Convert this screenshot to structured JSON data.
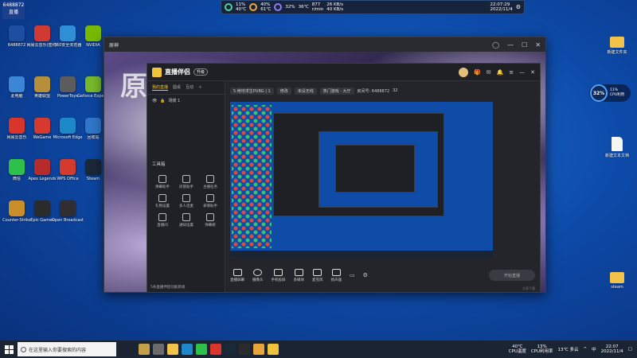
{
  "desktop": {
    "badge": {
      "line1": "6488872",
      "line2": "直播"
    },
    "icons": [
      {
        "label": "6488872",
        "color": "#1d4fa0"
      },
      {
        "label": "网易云音乐(签约)",
        "color": "#d03a32"
      },
      {
        "label": "360安全浏览器",
        "color": "#2f8fd6"
      },
      {
        "label": "NVIDIA",
        "color": "#76b900"
      },
      {
        "label": "此电脑",
        "color": "#3c86d6"
      },
      {
        "label": "英雄联盟",
        "color": "#b58f3a"
      },
      {
        "label": "PowerToys",
        "color": "#5c5c5c"
      },
      {
        "label": "Geforce Experience",
        "color": "#77b82b"
      },
      {
        "label": "网易云音乐",
        "color": "#d9352a"
      },
      {
        "label": "WeGame",
        "color": "#d63a2e"
      },
      {
        "label": "Microsoft Edge",
        "color": "#1c87c9"
      },
      {
        "label": "回收站",
        "color": "#2f77c9"
      },
      {
        "label": "微信",
        "color": "#2dc04a"
      },
      {
        "label": "Apex Legends",
        "color": "#b62b2b"
      },
      {
        "label": "WPS Office",
        "color": "#d33b2c"
      },
      {
        "label": "Steam",
        "color": "#1b2838"
      },
      {
        "label": "Counter-Strike",
        "color": "#c98e2a"
      },
      {
        "label": "Epic Games",
        "color": "#2b2b2b"
      },
      {
        "label": "Open Broadcaster",
        "color": "#302e31"
      }
    ],
    "right_icons": [
      {
        "label": "新建文件夹",
        "kind": "folder"
      },
      {
        "label": "新建文本文档",
        "kind": "file"
      },
      {
        "label": "steam",
        "kind": "folder"
      }
    ]
  },
  "monitor": {
    "cpu_pct": "11%",
    "cpu_temp": "40℃",
    "gpu_pct": "40%",
    "gpu_temp": "61℃",
    "mem": "32%",
    "disk_temp": "36℃",
    "fan": "877",
    "fan_unit": "r/min",
    "up": "26 KB/s",
    "down": "40 KB/s",
    "time": "22:07:29",
    "date": "2022/11/4"
  },
  "cpu_widget": {
    "value": "32%",
    "line1": "11%",
    "line2": "CPU利用"
  },
  "window": {
    "title": "原神",
    "art_text": "原"
  },
  "stream": {
    "brand": "直播伴侣",
    "brand_tag": "升级",
    "tabs": [
      "我的直播",
      "圆桌",
      "互动"
    ],
    "scene_label": "场景 1",
    "tools_title": "工具箱",
    "tools": [
      {
        "label": "弹幕助手"
      },
      {
        "label": "房管助手"
      },
      {
        "label": "主播任务"
      },
      {
        "label": "礼物设置"
      },
      {
        "label": "多人连麦"
      },
      {
        "label": "表情助手"
      },
      {
        "label": "直播间"
      },
      {
        "label": "通知设置"
      },
      {
        "label": "弹幕姬"
      }
    ],
    "left_footer": "5条直播伴侣功能新规",
    "info": {
      "game": "5.绝地求生PUBG | 1",
      "edit": "修改",
      "mode": "未设无线",
      "tag": "热门游戏 · 大厅",
      "room": "房间号: 6488872",
      "fans": "32"
    },
    "bottom_buttons": [
      {
        "label": "直播屏幕"
      },
      {
        "label": "摄像头"
      },
      {
        "label": "手机投屏"
      },
      {
        "label": "多媒体"
      },
      {
        "label": "麦克风"
      },
      {
        "label": "扬声器"
      }
    ],
    "start_label": "开始直播",
    "footer_right": "分享下载"
  },
  "taskbar": {
    "search_placeholder": "在这里输入你要搜索的内容",
    "tray_temp": "40℃",
    "tray_temp_label": "CPU温度",
    "tray_cpu": "13%",
    "tray_cpu_label": "CPU利用率",
    "weather": "13℃ 多云",
    "lang": "中",
    "time": "22:07",
    "date": "2022/11/4"
  }
}
